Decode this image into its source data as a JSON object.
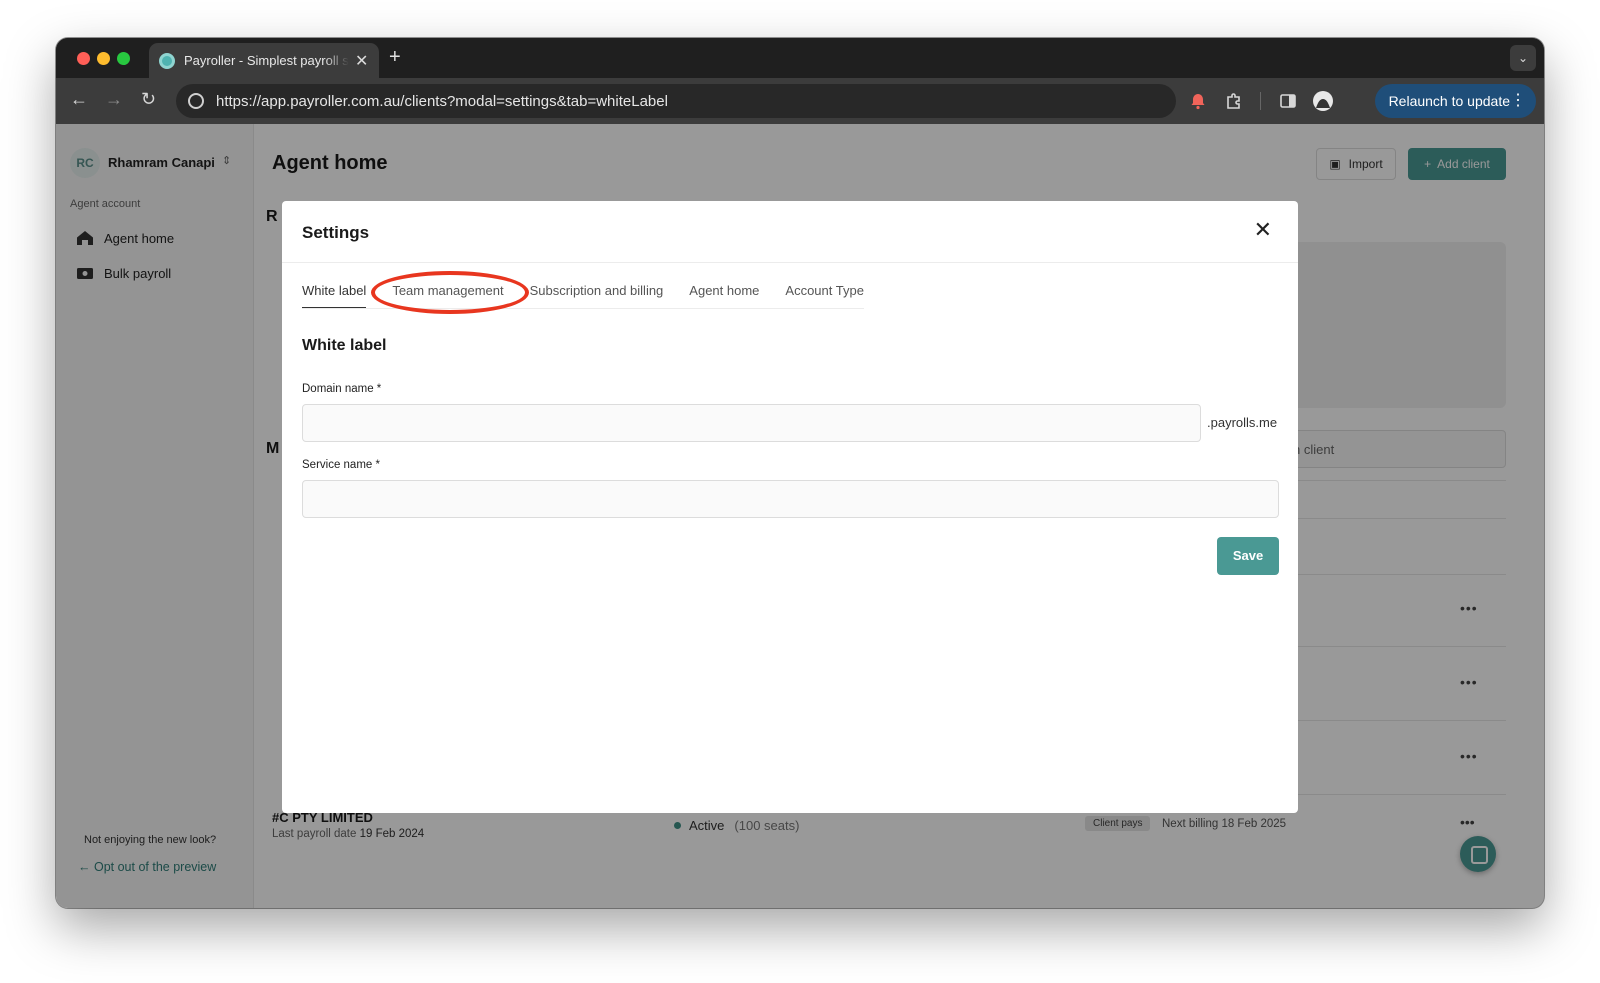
{
  "browser": {
    "tab_title": "Payroller - Simplest payroll software",
    "new_tab": "+",
    "url": "https://app.payroller.com.au/clients?modal=settings&tab=whiteLabel",
    "relaunch_label": "Relaunch to update"
  },
  "sidebar": {
    "avatar_initials": "RC",
    "user_name": "Rhamram Canapi",
    "section_label": "Agent account",
    "items": [
      {
        "label": "Agent home",
        "icon": "home-icon"
      },
      {
        "label": "Bulk payroll",
        "icon": "payroll-icon"
      }
    ],
    "footer_text": "Not enjoying the new look?",
    "footer_link": "Opt out of the preview"
  },
  "main": {
    "title": "Agent home",
    "import_label": "Import",
    "add_client_label": "Add client",
    "section_letter_1": "R",
    "section_letter_2": "M",
    "search_partial": "n client",
    "client": {
      "name": "#C PTY LIMITED",
      "last_payroll_label": "Last payroll date",
      "last_payroll_date": "19 Feb 2024",
      "status": "Active",
      "seats": "(100 seats)",
      "badge": "Client pays",
      "next_billing": "Next billing 18 Feb 2025"
    }
  },
  "modal": {
    "title": "Settings",
    "tabs": [
      "White label",
      "Team management",
      "Subscription and billing",
      "Agent home",
      "Account Type"
    ],
    "active_tab": "White label",
    "highlighted_tab": "Team management",
    "section_title": "White label",
    "domain_label": "Domain name *",
    "domain_value": "",
    "domain_suffix": ".payrolls.me",
    "service_label": "Service name *",
    "service_value": "",
    "save_label": "Save"
  },
  "colors": {
    "accent": "#4a9994",
    "highlight_ring": "#e8361f",
    "relaunch": "#1f4e79"
  }
}
